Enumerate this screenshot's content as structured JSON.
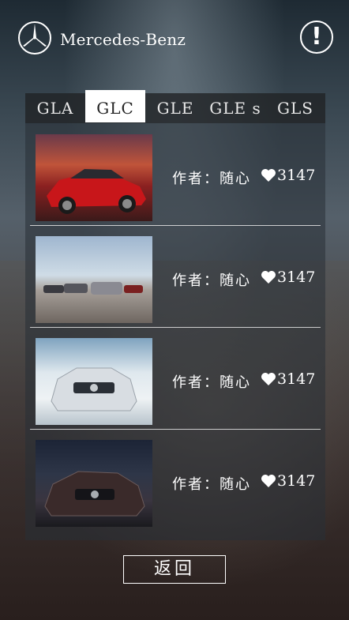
{
  "header": {
    "brand_name": "Mercedes-Benz",
    "info_icon": "!"
  },
  "tabs": [
    {
      "label": "GLA",
      "active": false
    },
    {
      "label": "GLC",
      "active": true
    },
    {
      "label": "GLE",
      "active": false
    },
    {
      "label": "GLE s",
      "active": false
    },
    {
      "label": "GLS",
      "active": false
    }
  ],
  "items": [
    {
      "author": "作者：随心",
      "likes": "3147",
      "thumb_icon": "red-car-photo"
    },
    {
      "author": "作者：随心",
      "likes": "3147",
      "thumb_icon": "car-group-photo"
    },
    {
      "author": "作者：随心",
      "likes": "3147",
      "thumb_icon": "white-car-photo"
    },
    {
      "author": "作者：随心",
      "likes": "3147",
      "thumb_icon": "dark-car-photo"
    }
  ],
  "footer": {
    "back_label": "返回"
  },
  "colors": {
    "text": "#ffffff",
    "active_tab_bg": "#ffffff",
    "active_tab_text": "#222222"
  }
}
